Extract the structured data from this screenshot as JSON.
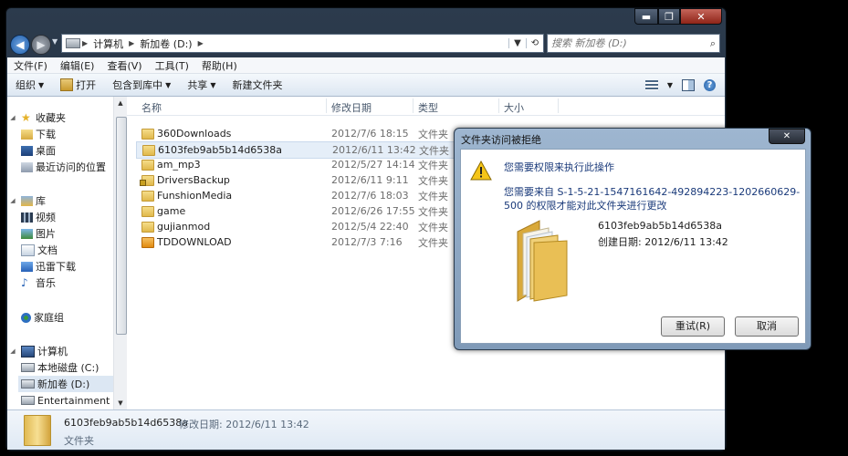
{
  "explorer": {
    "window_controls": {
      "minimize": "▬",
      "maximize": "❐",
      "close": "✕"
    },
    "nav": {
      "back": "◀",
      "forward": "▶"
    },
    "address": {
      "segments": [
        "计算机",
        "新加卷 (D:)"
      ]
    },
    "search": {
      "placeholder": "搜索 新加卷 (D:)"
    },
    "menu": [
      "文件(F)",
      "编辑(E)",
      "查看(V)",
      "工具(T)",
      "帮助(H)"
    ],
    "toolbar": {
      "organize": "组织",
      "open": "打开",
      "include_in_library": "包含到库中",
      "share": "共享",
      "new_folder": "新建文件夹"
    },
    "sidebar": {
      "favorites": "收藏夹",
      "downloads": "下载",
      "desktop": "桌面",
      "recent": "最近访问的位置",
      "libraries": "库",
      "videos": "视频",
      "pictures": "图片",
      "documents": "文档",
      "xunlei": "迅雷下载",
      "music": "音乐",
      "homegroup": "家庭组",
      "computer": "计算机",
      "local_c": "本地磁盘 (C:)",
      "vol_d": "新加卷 (D:)",
      "entertainment": "Entertainment ("
    },
    "columns": {
      "name": "名称",
      "date": "修改日期",
      "type": "类型",
      "size": "大小"
    },
    "files": [
      {
        "name": "360Downloads",
        "date": "2012/7/6 18:15",
        "type": "文件夹"
      },
      {
        "name": "6103feb9ab5b14d6538a",
        "date": "2012/6/11 13:42",
        "type": "文件夹"
      },
      {
        "name": "am_mp3",
        "date": "2012/5/27 14:14",
        "type": "文件夹"
      },
      {
        "name": "DriversBackup",
        "date": "2012/6/11 9:11",
        "type": "文件夹"
      },
      {
        "name": "FunshionMedia",
        "date": "2012/7/6 18:03",
        "type": "文件夹"
      },
      {
        "name": "game",
        "date": "2012/6/26 17:55",
        "type": "文件夹"
      },
      {
        "name": "gujianmod",
        "date": "2012/5/4 22:40",
        "type": "文件夹"
      },
      {
        "name": "TDDOWNLOAD",
        "date": "2012/7/3 7:16",
        "type": "文件夹"
      }
    ],
    "status": {
      "name": "6103feb9ab5b14d6538a",
      "date": "修改日期: 2012/6/11 13:42",
      "type": "文件夹"
    }
  },
  "dialog": {
    "title": "文件夹访问被拒绝",
    "message1": "您需要权限来执行此操作",
    "message2": "您需要来自 S-1-5-21-1547161642-492894223-1202660629-500 的权限才能对此文件夹进行更改",
    "folder_name": "6103feb9ab5b14d6538a",
    "created": "创建日期: 2012/6/11 13:42",
    "retry": "重试(R)",
    "cancel": "取消",
    "close": "✕"
  },
  "colors": {
    "accent": "#3399ff",
    "selection": "#dce7f3",
    "folder": "#e8c25a",
    "dialog_frame": "#8ea8c6"
  },
  "icons": [
    "back-arrow-icon",
    "forward-arrow-icon",
    "refresh-icon",
    "search-icon",
    "star-icon",
    "folder-icon",
    "drive-icon",
    "library-icon",
    "homegroup-icon",
    "computer-icon",
    "warning-icon",
    "help-icon"
  ]
}
